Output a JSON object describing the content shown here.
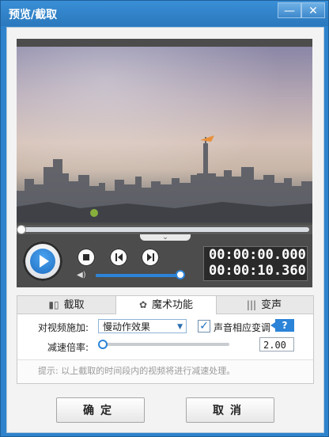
{
  "window": {
    "title": "预览/截取",
    "minimize_icon": "—",
    "close_icon": "✕"
  },
  "player": {
    "time_current": "00:00:00.000",
    "time_total": "00:00:10.360",
    "seek_progress": 0.0,
    "volume_level": 0.98,
    "collapse_icon": "⌄",
    "volume_icon": "◀)"
  },
  "tabs": [
    {
      "label": "截取",
      "icon": "▮▯",
      "active": false
    },
    {
      "label": "魔术功能",
      "icon": "✿",
      "active": true
    },
    {
      "label": "变声",
      "icon": "|||",
      "active": false
    }
  ],
  "magic": {
    "apply_label": "对视频施加:",
    "effect_value": "慢动作效果",
    "pitch_checkbox_label": "声音相应变调",
    "pitch_checked": true,
    "check_mark": "✓",
    "help_label": "?",
    "rate_label": "减速倍率:",
    "rate_value": "2.00",
    "hint": "提示: 以上截取的时间段内的视频将进行减速处理。"
  },
  "buttons": {
    "ok_label": "确定",
    "cancel_label": "取消"
  },
  "colors": {
    "accent": "#2b84d8",
    "titlebar": "#2f83cc"
  }
}
